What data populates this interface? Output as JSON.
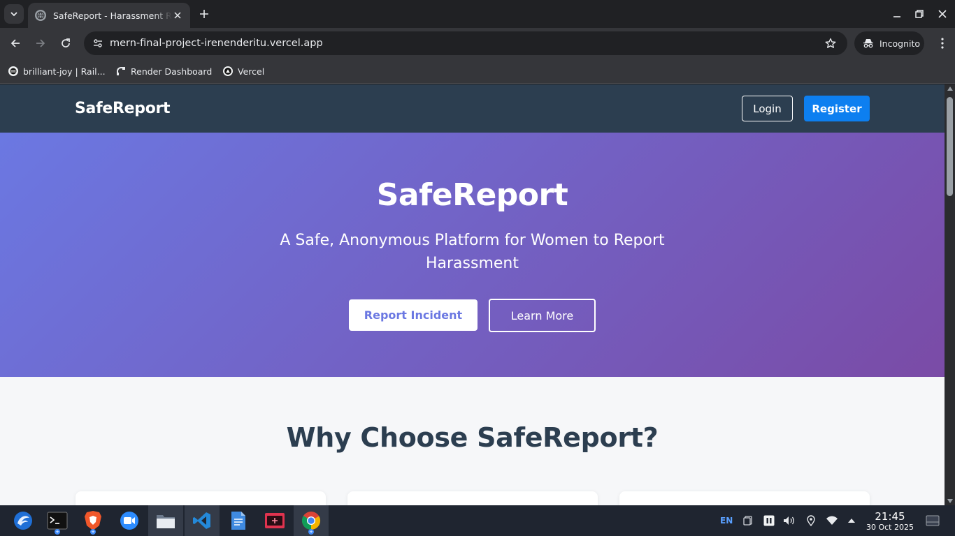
{
  "browser": {
    "tab_title": "SafeReport - Harassment Reporting",
    "url": "mern-final-project-irenenderitu.vercel.app",
    "incognito_label": "Incognito",
    "bookmarks": [
      {
        "label": "brilliant-joy | Rail...",
        "icon": "railway-icon"
      },
      {
        "label": "Render Dashboard",
        "icon": "render-icon"
      },
      {
        "label": "Vercel",
        "icon": "vercel-icon"
      }
    ]
  },
  "site": {
    "brand": "SafeReport",
    "login_label": "Login",
    "register_label": "Register",
    "accent_color": "#0d7ff0",
    "nav_color": "#2c3e50"
  },
  "hero": {
    "title": "SafeReport",
    "subtitle": "A Safe, Anonymous Platform for Women to Report Harassment",
    "report_button": "Report Incident",
    "learn_button": "Learn More",
    "gradient": [
      "#6b78e2",
      "#7a4ba6"
    ]
  },
  "features": {
    "title": "Why Choose SafeReport?"
  },
  "taskbar": {
    "apps": [
      "start-menu-icon",
      "terminal-icon",
      "brave-browser-icon",
      "zoom-icon",
      "file-manager-icon",
      "vscode-icon",
      "document-viewer-icon",
      "media-app-icon",
      "chrome-icon"
    ],
    "language": "EN",
    "time": "21:45",
    "date": "30 Oct 2025"
  }
}
